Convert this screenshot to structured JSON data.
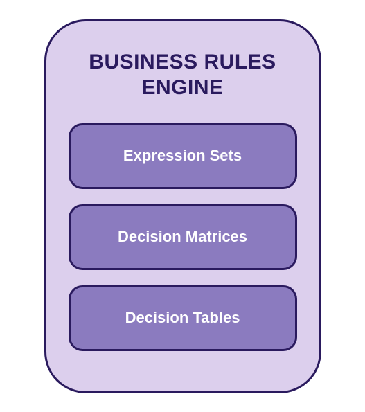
{
  "engine": {
    "title": "BUSINESS RULES ENGINE",
    "components": [
      {
        "label": "Expression Sets"
      },
      {
        "label": "Decision Matrices"
      },
      {
        "label": "Decision Tables"
      }
    ]
  },
  "colors": {
    "containerBg": "#dccfed",
    "containerBorder": "#2a1a5e",
    "boxBg": "#8b7bbf",
    "boxBorder": "#2a1a5e",
    "titleText": "#2a1a5e",
    "labelText": "#ffffff"
  }
}
